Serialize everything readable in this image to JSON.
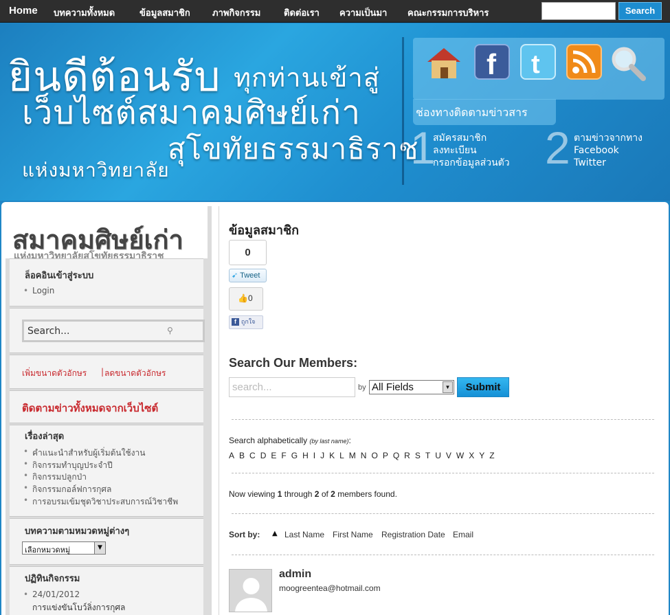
{
  "nav": {
    "home": "Home",
    "items": [
      "บทความทั้งหมด",
      "ข้อมูลสมาชิก",
      "ภาพกิจกรรม",
      "ติดต่อเรา",
      "ความเป็นมา",
      "คณะกรรมการบริหาร"
    ],
    "search_button": "Search"
  },
  "banner": {
    "line1a": "ยินดีต้อนรับ",
    "line1b": "ทุกท่านเข้าสู่",
    "line2": "เว็บไซต์สมาคมศิษย์เก่า",
    "line3a": "แห่งมหาวิทยาลัย",
    "line3b": "สุโขทัยธรรมาธิราช",
    "channel_title": "ช่องทางติดตามข่าวสาร",
    "icons": [
      "home-icon",
      "facebook-icon",
      "twitter-icon",
      "rss-icon",
      "search-icon"
    ],
    "step1_num": "1",
    "step1_lines": [
      "สมัครสมาชิก",
      "ลงทะเบียน",
      "กรอกข้อมูลส่วนตัว"
    ],
    "step2_num": "2",
    "step2_lines": [
      "ตามข่าวจากทาง",
      "Facebook",
      "Twitter"
    ]
  },
  "sidebar": {
    "logo_title": "สมาคมศิษย์เก่า",
    "logo_subtitle": "แห่งมหาวิทยาลัยสุโขทัยธรรมาธิราช",
    "login_title": "ล็อคอินเข้าสู่ระบบ",
    "login_link": "Login",
    "search_placeholder": "Search...",
    "font_increase": "เพิ่มขนาดตัวอักษร",
    "font_sep": "|",
    "font_decrease": "ลดขนาดตัวอักษร",
    "follow_all": "ติดตามข่าวทั้งหมดจากเว็บไซต์",
    "recent_title": "เรื่องล่าสุด",
    "recent": [
      "คำแนะนำสำหรับผู้เริ่มต้นใช้งาน",
      "กิจกรรมทำบุญประจำปี",
      "กิจกรรมปลูกป่า",
      "กิจกรรมกอล์ฟการกุศล",
      "การอบรมเข้มชุดวิชาประสบการณ์วิชาชีพ"
    ],
    "category_title": "บทความตามหมวดหมู่ต่างๆ",
    "category_select": "เลือกหมวดหมู่",
    "calendar_title": "ปฏิทินกิจกรรม",
    "calendar_date": "24/01/2012",
    "calendar_event": "การแข่งขันโบว์ลิ่งการกุศล"
  },
  "content": {
    "page_title": "ข้อมูลสมาชิก",
    "tweet_count": "0",
    "tweet_label": "Tweet",
    "like_count": "0",
    "like_label": "ถูกใจ",
    "search_heading": "Search Our Members:",
    "search_placeholder": "search...",
    "by_label": "by",
    "field_select": "All Fields",
    "submit_label": "Submit",
    "alpha_label": "Search alphabetically",
    "alpha_note": "(by last name)",
    "alpha_colon": ":",
    "letters": [
      "A",
      "B",
      "C",
      "D",
      "E",
      "F",
      "G",
      "H",
      "I",
      "J",
      "K",
      "L",
      "M",
      "N",
      "O",
      "P",
      "Q",
      "R",
      "S",
      "T",
      "U",
      "V",
      "W",
      "X",
      "Y",
      "Z"
    ],
    "viewing_prefix": "Now viewing",
    "viewing_from": "1",
    "viewing_through": "through",
    "viewing_to": "2",
    "viewing_of": "of",
    "viewing_total": "2",
    "viewing_suffix": "members found.",
    "sort_label": "Sort by:",
    "sort_options": [
      "Last Name",
      "First Name",
      "Registration Date",
      "Email"
    ],
    "member_name": "admin",
    "member_email": "moogreentea@hotmail.com"
  },
  "colors": {
    "banner_blue": "#1f8fd0",
    "nav_bg": "#2e2e2e",
    "submit_blue": "#1aa4e6",
    "red_link": "#c8282d"
  }
}
